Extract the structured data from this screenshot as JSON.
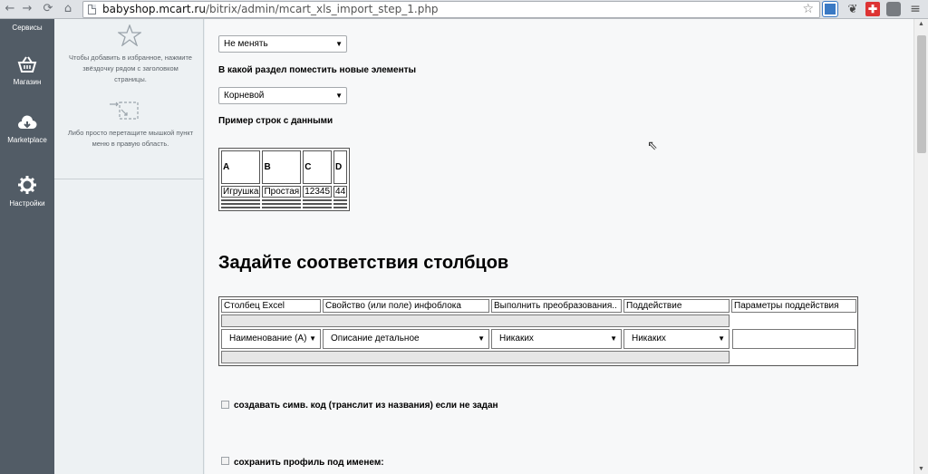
{
  "browser": {
    "url_host": "babyshop.mcart.ru",
    "url_path": "/bitrix/admin/mcart_xls_import_step_1.php"
  },
  "admin_menu": [
    {
      "label": "Сервисы",
      "icon": "services-icon"
    },
    {
      "label": "Магазин",
      "icon": "basket-icon"
    },
    {
      "label": "Marketplace",
      "icon": "cloud-download-icon"
    },
    {
      "label": "Настройки",
      "icon": "gear-icon"
    }
  ],
  "favorites": {
    "hint1": "Чтобы добавить в избранное, нажмите звёздочку рядом с заголовком страницы.",
    "hint2": "Либо просто перетащите мышкой пункт меню в правую область."
  },
  "form": {
    "mode_select": "Не менять",
    "section_label": "В какой раздел поместить новые элементы",
    "section_select": "Корневой",
    "sample_label": "Пример строк с данными",
    "sample_table": {
      "headers": [
        "A",
        "B",
        "C",
        "D"
      ],
      "row": [
        "Игрушка",
        "Простая",
        "12345",
        "44"
      ]
    },
    "mapping_title": "Задайте соответствия столбцов",
    "mapping_headers": [
      "Столбец Excel",
      "Свойство (или поле) инфоблока",
      "Выполнить преобразования..",
      "Поддействие",
      "Параметры поддействия"
    ],
    "mapping_row": {
      "excel_col": "Наименование (A)",
      "property": "Описание детальное",
      "transform": "Никаких",
      "subaction": "Никаких",
      "params": ""
    },
    "checkbox_code": "создавать симв. код (транслит из названия) если не задан",
    "checkbox_profile": "сохранить профиль под именем:"
  }
}
